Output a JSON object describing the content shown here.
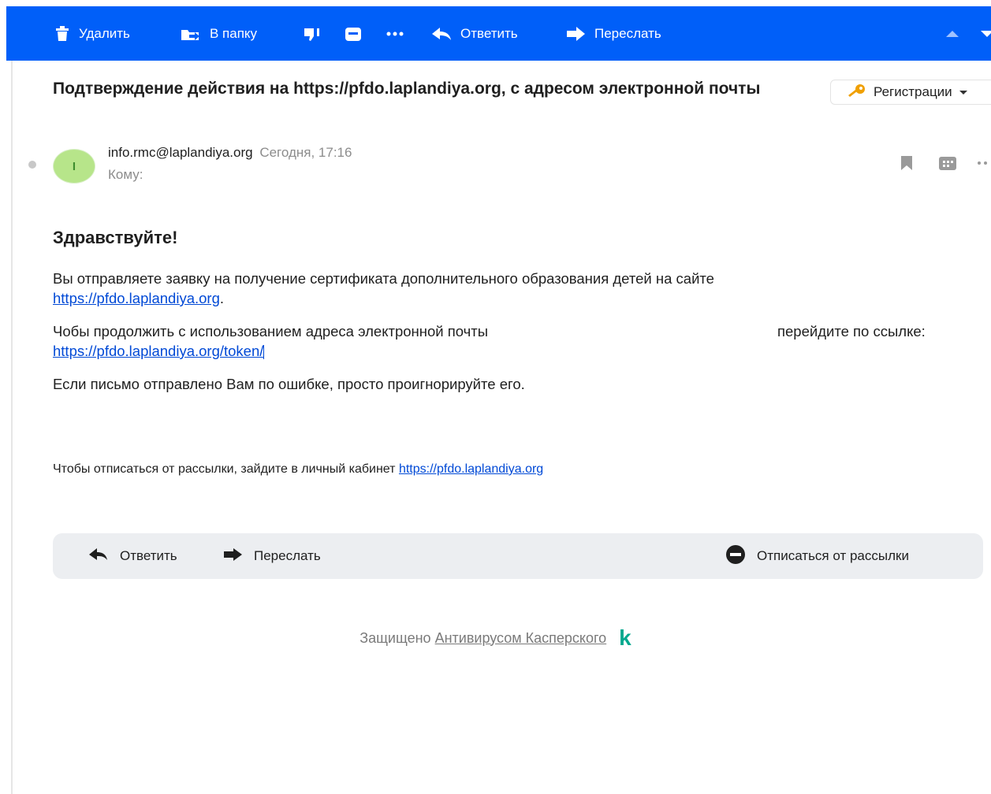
{
  "toolbar": {
    "delete_label": "Удалить",
    "folder_label": "В папку",
    "reply_label": "Ответить",
    "forward_label": "Переслать",
    "icons": [
      "trash-icon",
      "folder-move-icon",
      "spam-icon",
      "archive-icon",
      "more-icon",
      "reply-icon",
      "forward-icon",
      "scroll-up-icon",
      "scroll-down-icon"
    ],
    "bg_color": "#005ff9"
  },
  "message": {
    "subject": "Подтверждение действия на https://pfdo.laplandiya.org, с адресом электронной почты",
    "label_button": "Регистрации",
    "avatar_letter": "I",
    "sender_email": "info.rmc@laplandiya.org",
    "date": "Сегодня, 17:16",
    "to_label": "Кому:"
  },
  "body": {
    "greeting": "Здравствуйте!",
    "p1_text": "Вы отправляете заявку на получение сертификата дополнительного образования детей на сайте",
    "p1_link": "https://pfdo.laplandiya.org",
    "p1_end": ".",
    "p2_text": "Чобы продолжить с использованием адреса электронной почты",
    "p2_after": "перейдите по ссылке:",
    "p2_link": "https://pfdo.laplandiya.org/token/",
    "p3_text": "Если письмо отправлено Вам по ошибке, просто проигнорируйте его.",
    "unsub_text": "Чтобы отписаться от рассылки, зайдите в личный кабинет",
    "unsub_link": "https://pfdo.laplandiya.org"
  },
  "actions": {
    "reply_label": "Ответить",
    "forward_label": "Переслать",
    "unsubscribe_label": "Отписаться от рассылки"
  },
  "footer": {
    "protected_text": "Защищено",
    "antivirus_link": "Антивирусом Касперского",
    "logo_letter": "k"
  }
}
